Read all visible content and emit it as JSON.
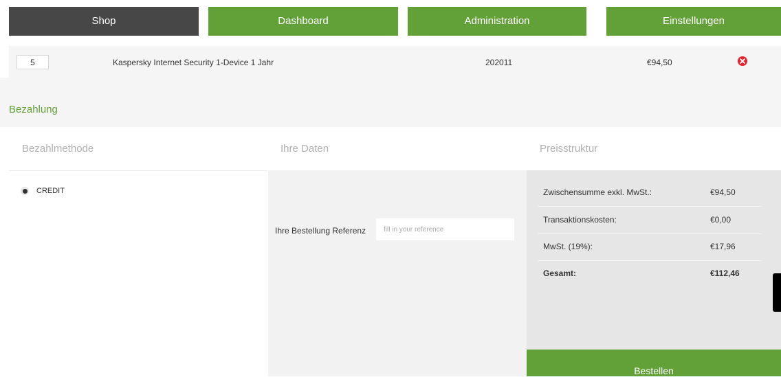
{
  "nav": {
    "items": [
      {
        "label": "Shop",
        "active": true
      },
      {
        "label": "Dashboard",
        "active": false
      },
      {
        "label": "Administration",
        "active": false
      },
      {
        "label": "Einstellungen",
        "active": false
      }
    ]
  },
  "cart": {
    "quantity": "5",
    "product": "Kaspersky Internet Security 1-Device 1 Jahr",
    "code": "202011",
    "price": "€94,50",
    "remove_icon": "remove-circle-icon"
  },
  "payment": {
    "title": "Bezahlung",
    "columns": {
      "method": "Bezahlmethode",
      "data": "Ihre Daten",
      "price": "Preisstruktur"
    },
    "method_option": "CREDIT",
    "reference_label": "Ihre Bestellung Referenz",
    "reference_placeholder": "fill in your reference",
    "reference_value": "",
    "summary": [
      {
        "label": "Zwischensumme exkl. MwSt.:",
        "value": "€94,50"
      },
      {
        "label": "Transaktionskosten:",
        "value": "€0,00"
      },
      {
        "label": "MwSt. (19%):",
        "value": "€17,96"
      },
      {
        "label": "Gesamt:",
        "value": "€112,46"
      }
    ],
    "order_button": "Bestellen"
  },
  "colors": {
    "accent_green": "#62a038",
    "nav_dark": "#474747",
    "remove_red": "#e8212a"
  }
}
